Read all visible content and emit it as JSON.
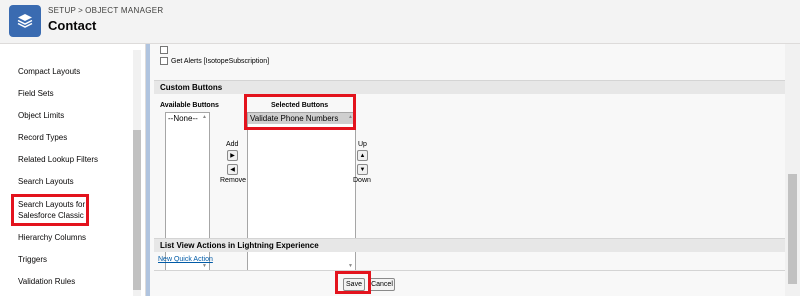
{
  "header": {
    "breadcrumb": [
      "SETUP",
      "OBJECT MANAGER"
    ],
    "breadcrumb_sep": ">",
    "title": "Contact",
    "icon": "layers-icon"
  },
  "sidebar": {
    "items": [
      {
        "label": "Compact Layouts"
      },
      {
        "label": "Field Sets"
      },
      {
        "label": "Object Limits"
      },
      {
        "label": "Record Types"
      },
      {
        "label": "Related Lookup Filters"
      },
      {
        "label": "Search Layouts"
      },
      {
        "label": "Search Layouts for Salesforce Classic"
      },
      {
        "label": "Hierarchy Columns"
      },
      {
        "label": "Triggers"
      },
      {
        "label": "Validation Rules"
      }
    ]
  },
  "main": {
    "checkbox_label": "Get Alerts [IsotopeSubscription]",
    "custom_buttons": {
      "title": "Custom Buttons",
      "available_label": "Available Buttons",
      "selected_label": "Selected Buttons",
      "available_options": [
        "--None--"
      ],
      "selected_options": [
        "Validate Phone Numbers"
      ],
      "add_label": "Add",
      "remove_label": "Remove",
      "up_label": "Up",
      "down_label": "Down"
    },
    "list_view": {
      "title": "List View Actions in Lightning Experience",
      "new_quick_action": "New Quick Action"
    },
    "save_label": "Save",
    "cancel_label": "Cancel"
  },
  "colors": {
    "highlight": "#e3131d",
    "accent": "#3a6bb1",
    "link": "#015ba7"
  }
}
